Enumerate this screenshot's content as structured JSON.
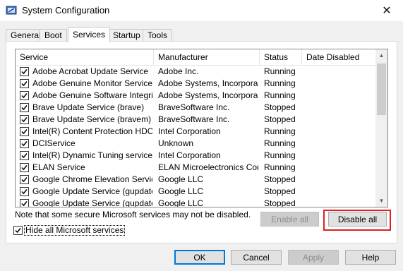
{
  "window": {
    "title": "System Configuration",
    "close_glyph": "✕"
  },
  "tabs": [
    "General",
    "Boot",
    "Services",
    "Startup",
    "Tools"
  ],
  "active_tab": "Services",
  "columns": [
    "Service",
    "Manufacturer",
    "Status",
    "Date Disabled"
  ],
  "rows": [
    {
      "service": "Adobe Acrobat Update Service",
      "manufacturer": "Adobe Inc.",
      "status": "Running",
      "date_disabled": "",
      "checked": true
    },
    {
      "service": "Adobe Genuine Monitor Service",
      "manufacturer": "Adobe Systems, Incorpora...",
      "status": "Running",
      "date_disabled": "",
      "checked": true
    },
    {
      "service": "Adobe Genuine Software Integri...",
      "manufacturer": "Adobe Systems, Incorpora...",
      "status": "Running",
      "date_disabled": "",
      "checked": true
    },
    {
      "service": "Brave Update Service (brave)",
      "manufacturer": "BraveSoftware Inc.",
      "status": "Stopped",
      "date_disabled": "",
      "checked": true
    },
    {
      "service": "Brave Update Service (bravem)",
      "manufacturer": "BraveSoftware Inc.",
      "status": "Stopped",
      "date_disabled": "",
      "checked": true
    },
    {
      "service": "Intel(R) Content Protection HDC...",
      "manufacturer": "Intel Corporation",
      "status": "Running",
      "date_disabled": "",
      "checked": true
    },
    {
      "service": "DCIService",
      "manufacturer": "Unknown",
      "status": "Running",
      "date_disabled": "",
      "checked": true
    },
    {
      "service": "Intel(R) Dynamic Tuning service",
      "manufacturer": "Intel Corporation",
      "status": "Running",
      "date_disabled": "",
      "checked": true
    },
    {
      "service": "ELAN Service",
      "manufacturer": "ELAN Microelectronics Corp.",
      "status": "Running",
      "date_disabled": "",
      "checked": true
    },
    {
      "service": "Google Chrome Elevation Servic...",
      "manufacturer": "Google LLC",
      "status": "Stopped",
      "date_disabled": "",
      "checked": true
    },
    {
      "service": "Google Update Service (gupdate)",
      "manufacturer": "Google LLC",
      "status": "Stopped",
      "date_disabled": "",
      "checked": true
    },
    {
      "service": "Google Update Service (gupdatem)",
      "manufacturer": "Google LLC",
      "status": "Stopped",
      "date_disabled": "",
      "checked": true
    }
  ],
  "note": "Note that some secure Microsoft services may not be disabled.",
  "buttons": {
    "enable_all": "Enable all",
    "disable_all": "Disable all",
    "ok": "OK",
    "cancel": "Cancel",
    "apply": "Apply",
    "help": "Help"
  },
  "hide_ms": {
    "label": "Hide all Microsoft services",
    "checked": true
  },
  "colors": {
    "highlight": "#e02020",
    "accent": "#0078d7"
  },
  "icons": {
    "app": "system-config-icon",
    "close": "close-icon",
    "check": "check-icon"
  }
}
